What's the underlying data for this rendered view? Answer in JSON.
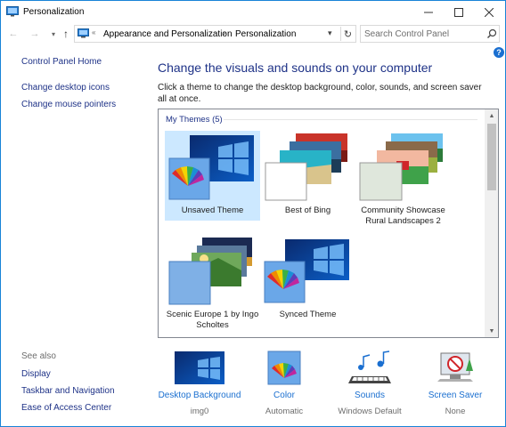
{
  "window": {
    "title": "Personalization"
  },
  "address": {
    "overflow": "«",
    "crumb1": "Appearance and Personalization",
    "separator": "›",
    "crumb2": "Personalization"
  },
  "search": {
    "placeholder": "Search Control Panel"
  },
  "left_nav": {
    "home": "Control Panel Home",
    "links": [
      "Change desktop icons",
      "Change mouse pointers"
    ],
    "see_also_title": "See also",
    "see_also": [
      "Display",
      "Taskbar and Navigation",
      "Ease of Access Center"
    ]
  },
  "help": "?",
  "main": {
    "heading": "Change the visuals and sounds on your computer",
    "description": "Click a theme to change the desktop background, color, sounds, and screen saver all at once."
  },
  "themes": {
    "group_label": "My Themes (5)",
    "items": [
      {
        "name": "Unsaved Theme",
        "selected": true
      },
      {
        "name": "Best of Bing",
        "selected": false
      },
      {
        "name": "Community Showcase Rural Landscapes 2",
        "selected": false
      },
      {
        "name": "Scenic Europe 1 by Ingo Scholtes",
        "selected": false
      },
      {
        "name": "Synced Theme",
        "selected": false
      }
    ]
  },
  "settings": [
    {
      "label": "Desktop Background",
      "value": "img0",
      "icon": "desktop-background-icon"
    },
    {
      "label": "Color",
      "value": "Automatic",
      "icon": "color-icon"
    },
    {
      "label": "Sounds",
      "value": "Windows Default",
      "icon": "sounds-icon"
    },
    {
      "label": "Screen Saver",
      "value": "None",
      "icon": "screen-saver-icon"
    }
  ],
  "colors": {
    "link": "#1e3287",
    "accent": "#1a6fd0",
    "selected_bg": "#cce8ff"
  }
}
